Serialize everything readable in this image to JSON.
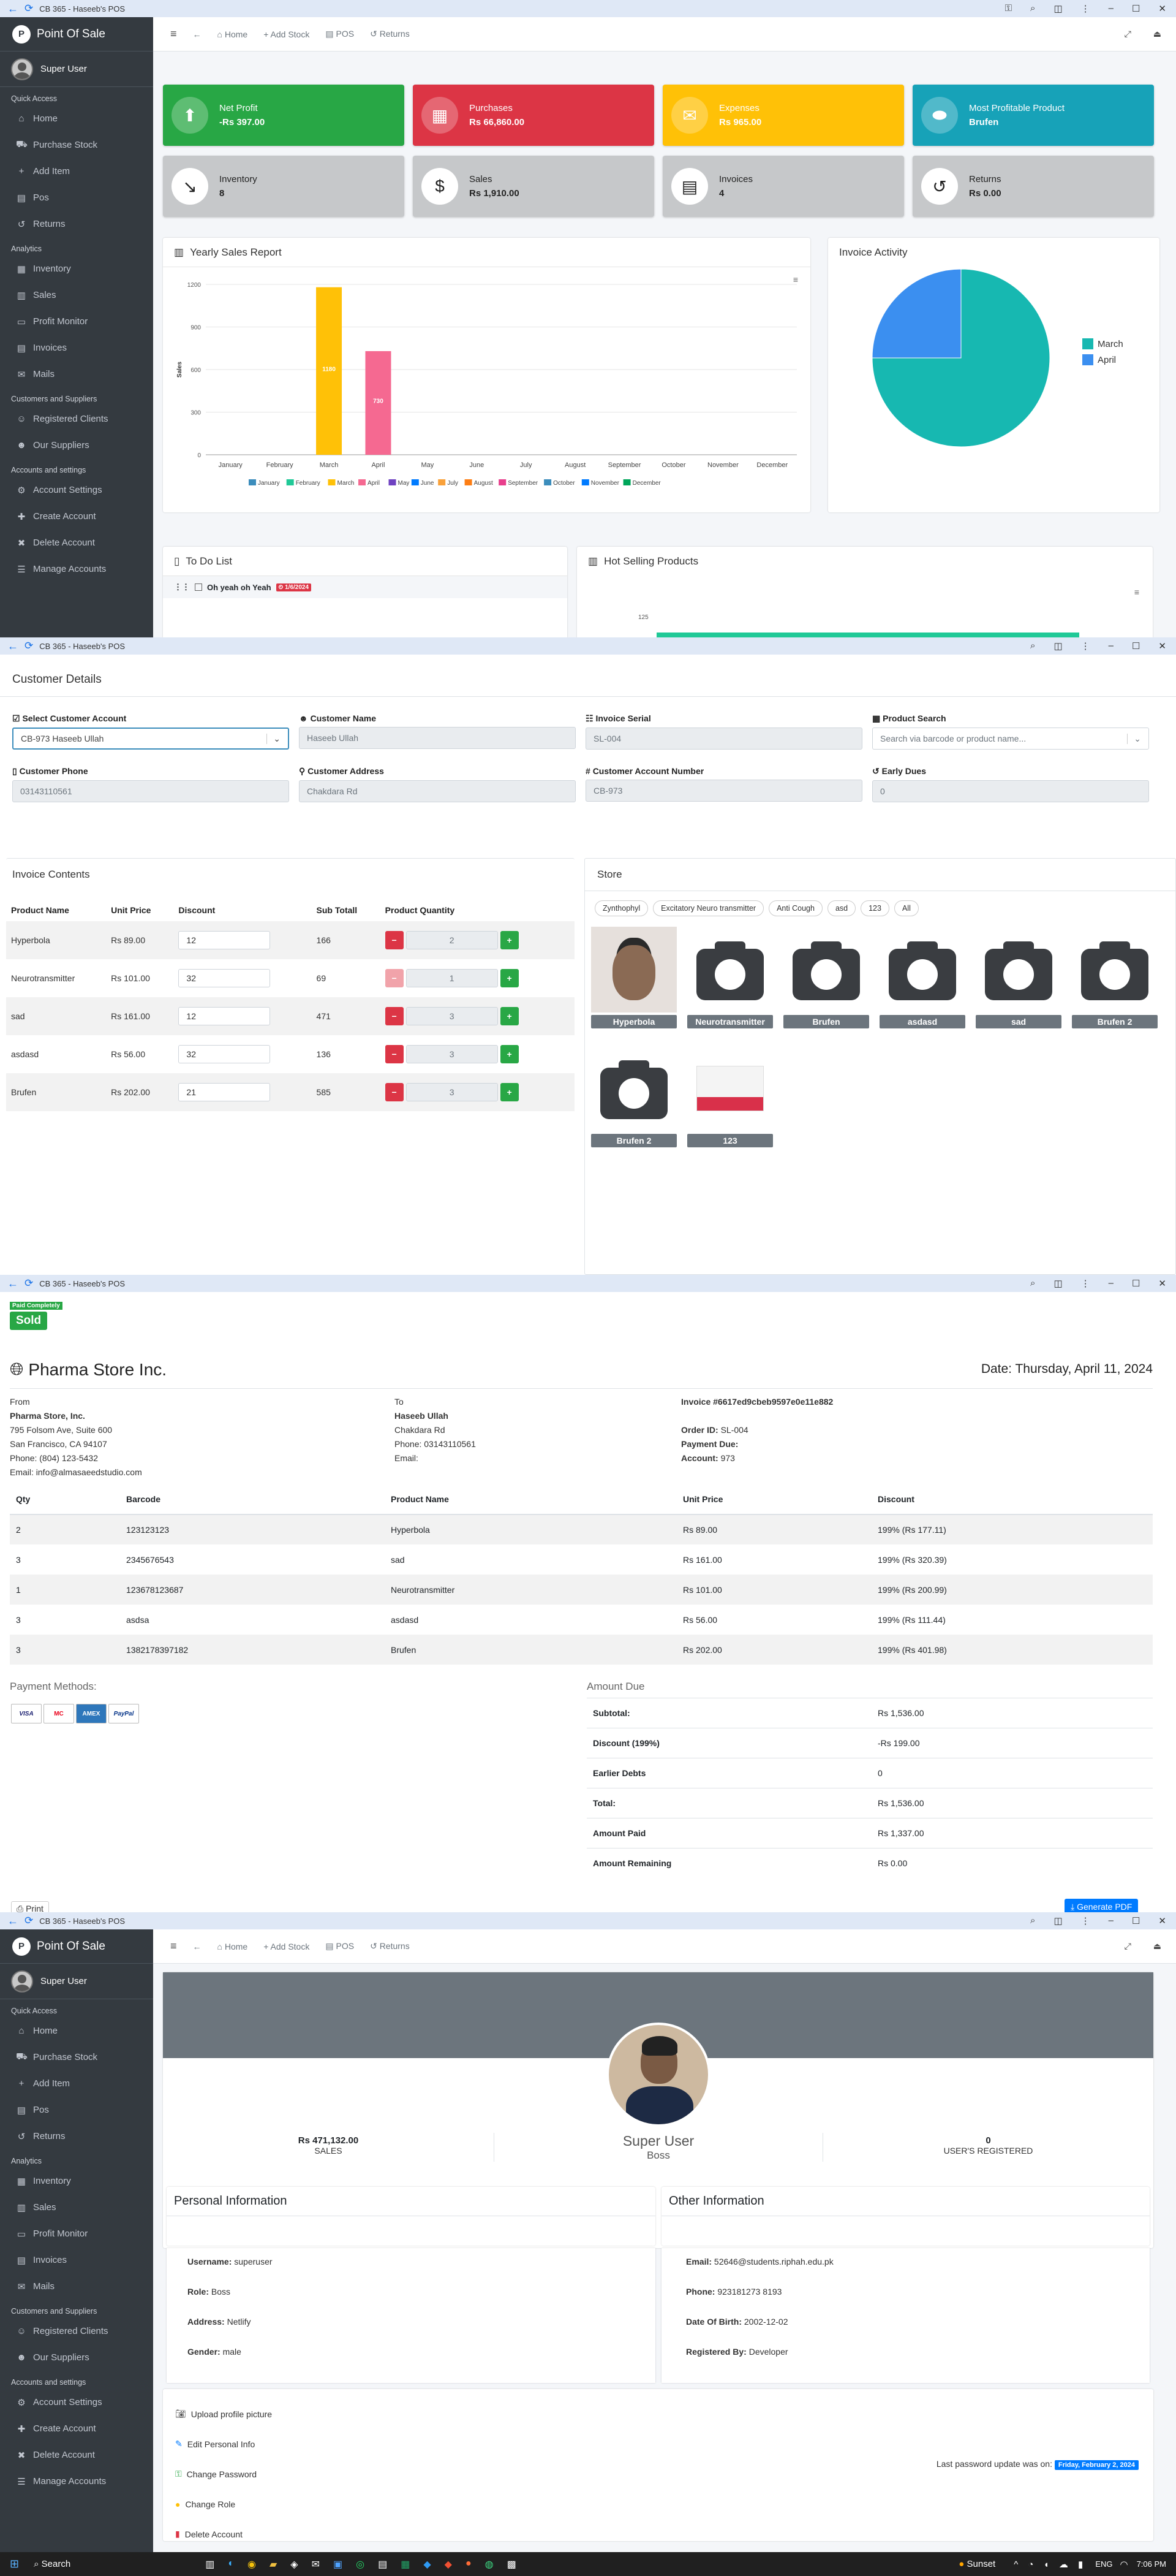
{
  "window": {
    "title": "CB 365 - Haseeb's POS"
  },
  "brand": "Point Of Sale",
  "user_name": "Super User",
  "sidebar": {
    "sections": [
      {
        "heading": "Quick Access",
        "items": [
          {
            "label": "Home",
            "icon": "home-icon",
            "glyph": "⌂"
          },
          {
            "label": "Purchase Stock",
            "icon": "truck-icon",
            "glyph": "⛟"
          },
          {
            "label": "Add Item",
            "icon": "plus-icon",
            "glyph": "+"
          },
          {
            "label": "Pos",
            "icon": "cash-register-icon",
            "glyph": "▤"
          },
          {
            "label": "Returns",
            "icon": "undo-icon",
            "glyph": "↺"
          }
        ]
      },
      {
        "heading": "Analytics",
        "items": [
          {
            "label": "Inventory",
            "icon": "box-icon",
            "glyph": "▦"
          },
          {
            "label": "Sales",
            "icon": "chart-icon",
            "glyph": "▥"
          },
          {
            "label": "Profit Monitor",
            "icon": "monitor-icon",
            "glyph": "▭"
          },
          {
            "label": "Invoices",
            "icon": "invoice-icon",
            "glyph": "▤"
          },
          {
            "label": "Mails",
            "icon": "mail-icon",
            "glyph": "✉"
          }
        ]
      },
      {
        "heading": "Customers and Suppliers",
        "items": [
          {
            "label": "Registered Clients",
            "icon": "users-icon",
            "glyph": "☺"
          },
          {
            "label": "Our Suppliers",
            "icon": "supplier-icon",
            "glyph": "☻"
          }
        ]
      },
      {
        "heading": "Accounts and settings",
        "items": [
          {
            "label": "Account Settings",
            "icon": "gear-icon",
            "glyph": "⚙"
          },
          {
            "label": "Create Account",
            "icon": "user-plus-icon",
            "glyph": "✚"
          },
          {
            "label": "Delete Account",
            "icon": "user-minus-icon",
            "glyph": "✖"
          },
          {
            "label": "Manage Accounts",
            "icon": "users-cog-icon",
            "glyph": "☰"
          }
        ]
      }
    ]
  },
  "topnav": {
    "home": "Home",
    "add_stock": "Add Stock",
    "pos": "POS",
    "returns": "Returns"
  },
  "stats": [
    {
      "label": "Net Profit",
      "value": "-Rs 397.00",
      "color": "#28a745",
      "icon": "arrow-up-icon",
      "glyph": "⬆"
    },
    {
      "label": "Purchases",
      "value": "Rs 66,860.00",
      "color": "#dc3545",
      "icon": "warehouse-icon",
      "glyph": "▦"
    },
    {
      "label": "Expenses",
      "value": "Rs 965.00",
      "color": "#ffc107",
      "icon": "envelope-money-icon",
      "glyph": "✉"
    },
    {
      "label": "Most Profitable Product",
      "value": "Brufen",
      "color": "#17a2b8",
      "icon": "pills-icon",
      "glyph": "⬬"
    },
    {
      "label": "Inventory",
      "value": "8",
      "color": "#c6c8ca",
      "icon": "trend-down-icon",
      "glyph": "↘"
    },
    {
      "label": "Sales",
      "value": "Rs 1,910.00",
      "color": "#c6c8ca",
      "icon": "dollar-icon",
      "glyph": "$"
    },
    {
      "label": "Invoices",
      "value": "4",
      "color": "#c6c8ca",
      "icon": "file-invoice-icon",
      "glyph": "▤"
    },
    {
      "label": "Returns",
      "value": "Rs 0.00",
      "color": "#c6c8ca",
      "icon": "undo-icon",
      "glyph": "↺"
    }
  ],
  "yearly": {
    "title": "Yearly Sales Report",
    "invoice_title": "Invoice Activity"
  },
  "chart_data": [
    {
      "type": "bar",
      "title": "Yearly Sales Report",
      "ylabel": "Sales",
      "ylim": [
        0,
        1200
      ],
      "yticks": [
        0,
        300,
        600,
        900,
        1200
      ],
      "categories": [
        "January",
        "February",
        "March",
        "April",
        "May",
        "June",
        "July",
        "August",
        "September",
        "October",
        "November",
        "December"
      ],
      "values": [
        0,
        0,
        1180,
        730,
        0,
        0,
        0,
        0,
        0,
        0,
        0,
        0
      ],
      "data_labels": [
        "",
        "",
        "1180",
        "730",
        "",
        "",
        "",
        "",
        "",
        "",
        "",
        ""
      ],
      "colors": [
        "#3c8dbc",
        "#20c997",
        "#ffc107",
        "#f56991",
        "#6f42c1",
        "#007bff",
        "#f9a13a",
        "#fd7e14",
        "#e83e8c",
        "#3c8dbc",
        "#007bff",
        "#00a65a"
      ],
      "legend": "bottom"
    },
    {
      "type": "pie",
      "title": "Invoice Activity",
      "labels": [
        "March",
        "April"
      ],
      "values": [
        75,
        25
      ],
      "colors": [
        "#17b8b1",
        "#3b8ff0"
      ],
      "legend": "right"
    }
  ],
  "todo": {
    "title": "To Do List",
    "items": [
      {
        "text": "Oh yeah oh Yeah",
        "badge": "1/6/2024"
      }
    ]
  },
  "hot": {
    "title": "Hot Selling Products",
    "axis_value": "125"
  },
  "customer": {
    "heading": "Customer Details",
    "select_label": "Select Customer Account",
    "select_value": "CB-973 Haseeb Ullah",
    "name_label": "Customer Name",
    "name_value": "Haseeb Ullah",
    "serial_label": "Invoice Serial",
    "serial_value": "SL-004",
    "search_label": "Product Search",
    "search_placeholder": "Search via barcode or product name...",
    "phone_label": "Customer Phone",
    "phone_value": "03143110561",
    "address_label": "Customer Address",
    "address_value": "Chakdara Rd",
    "acct_label": "Customer Account Number",
    "acct_value": "CB-973",
    "dues_label": "Early Dues",
    "dues_value": "0"
  },
  "invoice_contents": {
    "title": "Invoice Contents",
    "headers": [
      "Product Name",
      "Unit Price",
      "Discount",
      "Sub Totall",
      "Product Quantity"
    ],
    "rows": [
      {
        "name": "Hyperbola",
        "price": "Rs 89.00",
        "discount": "12",
        "subtotal": "166",
        "qty": "2"
      },
      {
        "name": "Neurotransmitter",
        "price": "Rs 101.00",
        "discount": "32",
        "subtotal": "69",
        "qty": "1"
      },
      {
        "name": "sad",
        "price": "Rs 161.00",
        "discount": "12",
        "subtotal": "471",
        "qty": "3"
      },
      {
        "name": "asdasd",
        "price": "Rs 56.00",
        "discount": "32",
        "subtotal": "136",
        "qty": "3"
      },
      {
        "name": "Brufen",
        "price": "Rs 202.00",
        "discount": "21",
        "subtotal": "585",
        "qty": "3"
      }
    ]
  },
  "store": {
    "title": "Store",
    "tags": [
      "Zynthophyl",
      "Excitatory Neuro transmitter",
      "Anti Cough",
      "asd",
      "123",
      "All"
    ],
    "products": [
      "Hyperbola",
      "Neurotransmitter",
      "Brufen",
      "asdasd",
      "sad",
      "Brufen 2",
      "Brufen 2",
      "123"
    ]
  },
  "invoice": {
    "badge_small": "Paid Completely",
    "badge": "Sold",
    "company": "Pharma Store Inc.",
    "date": "Date: Thursday, April 11, 2024",
    "from_label": "From",
    "from_name": "Pharma Store, Inc.",
    "from_addr1": "795 Folsom Ave, Suite 600",
    "from_addr2": "San Francisco, CA 94107",
    "from_phone": "Phone: (804) 123-5432",
    "from_email": "Email: info@almasaeedstudio.com",
    "to_label": "To",
    "to_name": "Haseeb Ullah",
    "to_addr": "Chakdara Rd",
    "to_phone": "Phone: 03143110561",
    "to_email": "Email:",
    "invoice_no": "Invoice #6617ed9cbeb9597e0e11e882",
    "order_label": "Order ID:",
    "order_id": "SL-004",
    "due_label": "Payment Due:",
    "acct_label": "Account:",
    "acct": "973",
    "headers": [
      "Qty",
      "Barcode",
      "Product Name",
      "Unit Price",
      "Discount"
    ],
    "rows": [
      [
        "2",
        "123123123",
        "Hyperbola",
        "Rs 89.00",
        "199% (Rs 177.11)"
      ],
      [
        "3",
        "2345676543",
        "sad",
        "Rs 161.00",
        "199% (Rs 320.39)"
      ],
      [
        "1",
        "123678123687",
        "Neurotransmitter",
        "Rs 101.00",
        "199% (Rs 200.99)"
      ],
      [
        "3",
        "asdsa",
        "asdasd",
        "Rs 56.00",
        "199% (Rs 111.44)"
      ],
      [
        "3",
        "1382178397182",
        "Brufen",
        "Rs 202.00",
        "199% (Rs 401.98)"
      ]
    ],
    "payment_label": "Payment Methods:",
    "cards": [
      "VISA",
      "MC",
      "AMEX",
      "PayPal"
    ],
    "amount_title": "Amount Due",
    "amounts": [
      [
        "Subtotal:",
        "Rs 1,536.00"
      ],
      [
        "Discount (199%)",
        "-Rs 199.00"
      ],
      [
        "Earlier Debts",
        "0"
      ],
      [
        "Total:",
        "Rs 1,536.00"
      ],
      [
        "Amount Paid",
        "Rs 1,337.00"
      ],
      [
        "Amount Remaining",
        "Rs 0.00"
      ]
    ],
    "print": "Print",
    "pdf": "Generate PDF"
  },
  "profile": {
    "sales_value": "Rs 471,132.00",
    "sales_label": "SALES",
    "name": "Super User",
    "role": "Boss",
    "users_value": "0",
    "users_label": "USER'S REGISTERED",
    "personal_title": "Personal Information",
    "personal": [
      [
        "Username:",
        "superuser"
      ],
      [
        "Role:",
        "Boss"
      ],
      [
        "Address:",
        "Netlify"
      ],
      [
        "Gender:",
        "male"
      ]
    ],
    "other_title": "Other Information",
    "other": [
      [
        "Email:",
        "52646@students.riphah.edu.pk"
      ],
      [
        "Phone:",
        "923181273 8193"
      ],
      [
        "Date Of Birth:",
        "2002-12-02"
      ],
      [
        "Registered By:",
        "Developer"
      ]
    ],
    "actions": [
      "Upload profile picture",
      "Edit Personal Info",
      "Change Password",
      "Change Role",
      "Delete Account"
    ],
    "pw_note": "Last password update was on:",
    "pw_date": "Friday, February 2, 2024"
  },
  "taskbar": {
    "search": "Search",
    "weather": "Sunset",
    "lang": "ENG",
    "time": "7:06 PM"
  }
}
